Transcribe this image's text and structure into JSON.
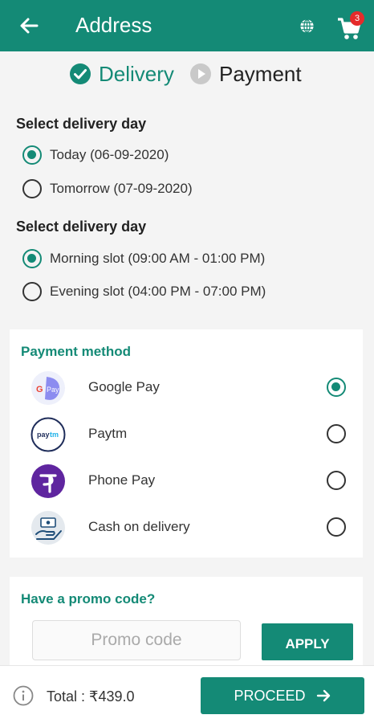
{
  "appbar": {
    "title": "Address",
    "cart_count": "3"
  },
  "steps": {
    "delivery": "Delivery",
    "payment": "Payment"
  },
  "delivery_day": {
    "title": "Select delivery day",
    "options": [
      "Today (06-09-2020)",
      "Tomorrow (07-09-2020)"
    ],
    "selected": 0
  },
  "delivery_slot": {
    "title": "Select delivery day",
    "options": [
      "Morning slot (09:00 AM - 01:00 PM)",
      "Evening slot  (04:00 PM - 07:00 PM)"
    ],
    "selected": 0
  },
  "payment": {
    "title": "Payment method",
    "methods": [
      {
        "label": "Google Pay",
        "icon": "google-pay-icon",
        "selected": true
      },
      {
        "label": "Paytm",
        "icon": "paytm-icon",
        "selected": false
      },
      {
        "label": "Phone Pay",
        "icon": "phonepe-icon",
        "selected": false
      },
      {
        "label": "Cash on delivery",
        "icon": "cash-on-delivery-icon",
        "selected": false
      }
    ]
  },
  "promo": {
    "title": "Have a promo code?",
    "placeholder": "Promo code",
    "apply_label": "APPLY"
  },
  "footer": {
    "total": "Total : ₹439.0",
    "proceed_label": "PROCEED"
  },
  "colors": {
    "accent": "#148a76",
    "badge": "#e52b2b"
  }
}
